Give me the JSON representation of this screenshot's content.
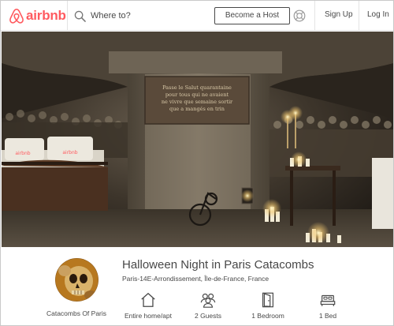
{
  "brand": {
    "name": "airbnb",
    "color": "#ff5a5f"
  },
  "header": {
    "search_placeholder": "Where to?",
    "become_host_label": "Become a Host",
    "help_icon": "help-circle-icon",
    "signup_label": "Sign Up",
    "login_label": "Log In"
  },
  "hero": {
    "plaque_lines": [
      "Passe le Salut quarantaine",
      "pour tous qui ne avaient",
      "ne vivre que semaine sortir",
      "que a mangés en trin"
    ]
  },
  "listing": {
    "title": "Halloween Night in Paris Catacombs",
    "location": "Paris-14E-Arrondissement, Île-de-France, France",
    "host_name": "Catacombs Of Paris",
    "amenities": [
      {
        "icon": "home-icon",
        "label": "Entire home/apt"
      },
      {
        "icon": "guests-icon",
        "label": "2 Guests"
      },
      {
        "icon": "door-icon",
        "label": "1 Bedroom"
      },
      {
        "icon": "bed-icon",
        "label": "1 Bed"
      }
    ]
  }
}
